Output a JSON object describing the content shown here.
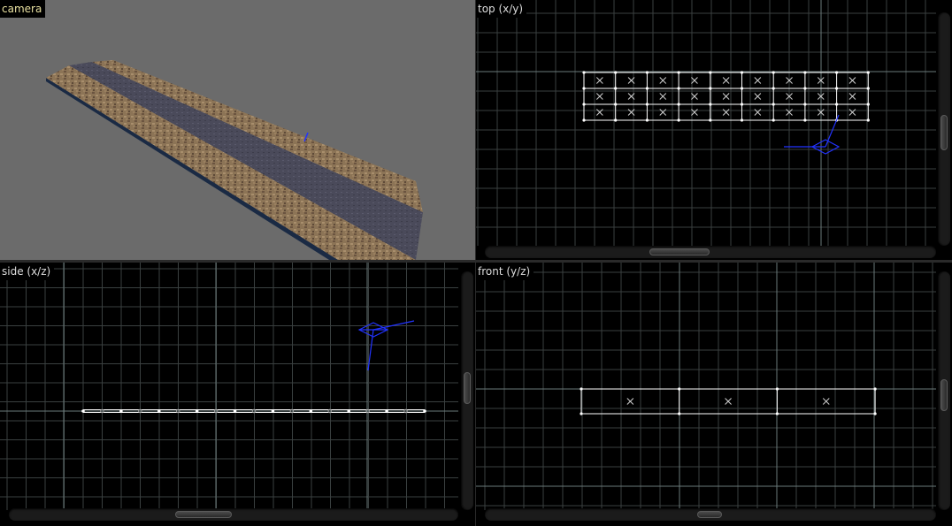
{
  "viewports": {
    "camera": {
      "label": "camera"
    },
    "top": {
      "label": "top (x/y)"
    },
    "side": {
      "label": "side (x/z)"
    },
    "front": {
      "label": "front (y/z)"
    }
  },
  "colors": {
    "camera_bg": "#6b6b6b",
    "ortho_bg": "#000000",
    "grid_minor": "#3a4040",
    "grid_major": "#6a7a7a",
    "mesh_wire": "#ffffff",
    "gizmo": "#2233ff",
    "label_active": "#e8e0a0",
    "label_inactive": "#dcdcdc"
  }
}
